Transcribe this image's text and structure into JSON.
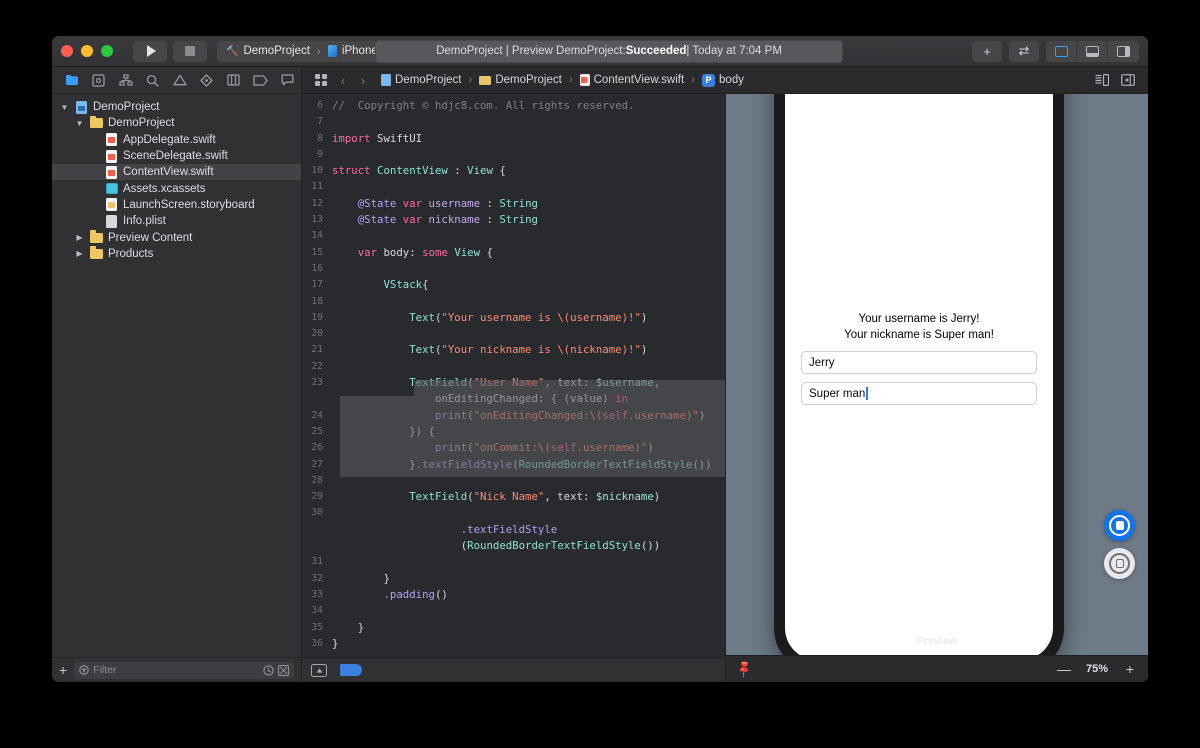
{
  "toolbar": {
    "scheme_project": "DemoProject",
    "scheme_sep": "›",
    "scheme_device": "iPhone Xʀ",
    "status_prefix": "DemoProject | Preview DemoProject: ",
    "status_bold": "Succeeded",
    "status_suffix": " | Today at 7:04 PM",
    "add_label": "+",
    "swap_label": "⇄"
  },
  "navigator_icons": [
    {
      "name": "folder-navigator",
      "active": true
    },
    {
      "name": "source-control-navigator",
      "active": false
    },
    {
      "name": "symbol-navigator",
      "active": false
    },
    {
      "name": "find-navigator",
      "active": false
    },
    {
      "name": "issue-navigator",
      "active": false
    },
    {
      "name": "test-navigator",
      "active": false
    },
    {
      "name": "debug-navigator",
      "active": false
    },
    {
      "name": "breakpoint-navigator",
      "active": false
    },
    {
      "name": "report-navigator",
      "active": false
    }
  ],
  "breadcrumb": {
    "back": "‹",
    "forward": "›",
    "separator": "›",
    "items": [
      {
        "label": "DemoProject",
        "icon": "project-icon"
      },
      {
        "label": "DemoProject",
        "icon": "folder-icon"
      },
      {
        "label": "ContentView.swift",
        "icon": "swift-file-icon"
      },
      {
        "label": "body",
        "icon": "property-icon"
      }
    ]
  },
  "sidebar": {
    "tree": [
      {
        "label": "DemoProject",
        "indent": 0,
        "twisty": "▼",
        "icon": "project-icon",
        "selected": false
      },
      {
        "label": "DemoProject",
        "indent": 1,
        "twisty": "▼",
        "icon": "folder-icon",
        "selected": false
      },
      {
        "label": "AppDelegate.swift",
        "indent": 2,
        "twisty": "",
        "icon": "swift-file-icon",
        "selected": false
      },
      {
        "label": "SceneDelegate.swift",
        "indent": 2,
        "twisty": "",
        "icon": "swift-file-icon",
        "selected": false
      },
      {
        "label": "ContentView.swift",
        "indent": 2,
        "twisty": "",
        "icon": "swift-file-icon",
        "selected": true
      },
      {
        "label": "Assets.xcassets",
        "indent": 2,
        "twisty": "",
        "icon": "assets-icon",
        "selected": false
      },
      {
        "label": "LaunchScreen.storyboard",
        "indent": 2,
        "twisty": "",
        "icon": "storyboard-icon",
        "selected": false
      },
      {
        "label": "Info.plist",
        "indent": 2,
        "twisty": "",
        "icon": "plist-icon",
        "selected": false
      },
      {
        "label": "Preview Content",
        "indent": 1,
        "twisty": "▶",
        "icon": "folder-icon",
        "selected": false
      },
      {
        "label": "Products",
        "indent": 1,
        "twisty": "▶",
        "icon": "folder-icon",
        "selected": false
      }
    ],
    "filter_placeholder": "Filter",
    "add_label": "+"
  },
  "editor": {
    "lines": [
      {
        "num": "6",
        "html": "<span class=\"c\">//  Copyright © hdjc8.com. All rights reserved.</span>"
      },
      {
        "num": "7",
        "html": ""
      },
      {
        "num": "8",
        "html": "<span class=\"k\">import</span> <span class=\"p\">SwiftUI</span>"
      },
      {
        "num": "9",
        "html": ""
      },
      {
        "num": "10",
        "html": "<span class=\"k\">struct</span> <span class=\"t\">ContentView</span> <span class=\"p\">:</span> <span class=\"t\">View</span> <span class=\"p\">{</span>"
      },
      {
        "num": "11",
        "html": ""
      },
      {
        "num": "12",
        "html": "    <span class=\"m\">@State</span> <span class=\"k\">var</span> <span class=\"v\">username</span> <span class=\"p\">:</span> <span class=\"t\">String</span>"
      },
      {
        "num": "13",
        "html": "    <span class=\"m\">@State</span> <span class=\"k\">var</span> <span class=\"v\">nickname</span> <span class=\"p\">:</span> <span class=\"t\">String</span>"
      },
      {
        "num": "14",
        "html": ""
      },
      {
        "num": "15",
        "html": "    <span class=\"k\">var</span> <span class=\"p\">body:</span> <span class=\"k\">some</span> <span class=\"t\">View</span> <span class=\"p\">{</span>"
      },
      {
        "num": "16",
        "html": ""
      },
      {
        "num": "17",
        "html": "        <span class=\"t\">VStack</span><span class=\"p\">{</span>"
      },
      {
        "num": "18",
        "html": ""
      },
      {
        "num": "19",
        "html": "            <span class=\"t\">Text</span><span class=\"p\">(</span><span class=\"s\">\"Your username is \\(username)!\"</span><span class=\"p\">)</span>"
      },
      {
        "num": "20",
        "html": ""
      },
      {
        "num": "21",
        "html": "            <span class=\"t\">Text</span><span class=\"p\">(</span><span class=\"s\">\"Your nickname is \\(nickname)!\"</span><span class=\"p\">)</span>"
      },
      {
        "num": "22",
        "html": ""
      },
      {
        "num": "23",
        "html": "            <span class=\"t\">TextField</span><span class=\"p\">(</span><span class=\"s\">\"User Name\"</span><span class=\"p\">, text:</span> <span class=\"g\">$username</span><span class=\"p\">,</span>"
      },
      {
        "num": "",
        "html": "                <span class=\"p\">onEditingChanged: { (value)</span> <span class=\"k\">in</span>"
      },
      {
        "num": "24",
        "html": "                <span class=\"m\">print</span><span class=\"p\">(</span><span class=\"s\">\"onEditingChanged:\\(</span><span class=\"k\">self</span><span class=\"s\">.username)\"</span><span class=\"p\">)</span>"
      },
      {
        "num": "25",
        "html": "            <span class=\"p\">}) {</span>"
      },
      {
        "num": "26",
        "html": "                <span class=\"m\">print</span><span class=\"p\">(</span><span class=\"s\">\"onCommit:\\(</span><span class=\"k\">self</span><span class=\"s\">.username)\"</span><span class=\"p\">)</span>"
      },
      {
        "num": "27",
        "html": "            <span class=\"p\">}</span><span class=\"m\">.textFieldStyle</span><span class=\"p\">(</span><span class=\"t\">RoundedBorderTextFieldStyle</span><span class=\"p\">())</span>"
      },
      {
        "num": "28",
        "html": ""
      },
      {
        "num": "29",
        "html": "            <span class=\"t\">TextField</span><span class=\"p\">(</span><span class=\"s\">\"Nick Name\"</span><span class=\"p\">, text:</span> <span class=\"g\">$nickname</span><span class=\"p\">)</span>"
      },
      {
        "num": "30",
        "html": ""
      },
      {
        "num": "",
        "html": "                    <span class=\"m\">.textFieldStyle</span>"
      },
      {
        "num": "",
        "html": "                    <span class=\"p\">(</span><span class=\"t\">RoundedBorderTextFieldStyle</span><span class=\"p\">())</span>"
      },
      {
        "num": "31",
        "html": ""
      },
      {
        "num": "32",
        "html": "        <span class=\"p\">}</span>"
      },
      {
        "num": "33",
        "html": "        <span class=\"m\">.padding</span><span class=\"p\">()</span>"
      },
      {
        "num": "34",
        "html": ""
      },
      {
        "num": "35",
        "html": "    <span class=\"p\">}</span>"
      },
      {
        "num": "36",
        "html": "<span class=\"p\">}</span>"
      }
    ]
  },
  "canvas": {
    "preview_label": "Preview",
    "app": {
      "username_line": "Your username is Jerry!",
      "nickname_line": "Your nickname is Super man!",
      "field_username": "Jerry",
      "field_nickname": "Super man"
    },
    "live_preview_button": "live-preview",
    "device_preview_button": "preview-on-device",
    "zoom_out": "—",
    "zoom_value": "75%",
    "zoom_in": "+"
  },
  "colors": {
    "accent_blue": "#3b9dff",
    "live_blue": "#1473e6",
    "canvas_bg": "#6d7a87",
    "editor_bg": "#292a2e",
    "success_green": "#28c840"
  }
}
